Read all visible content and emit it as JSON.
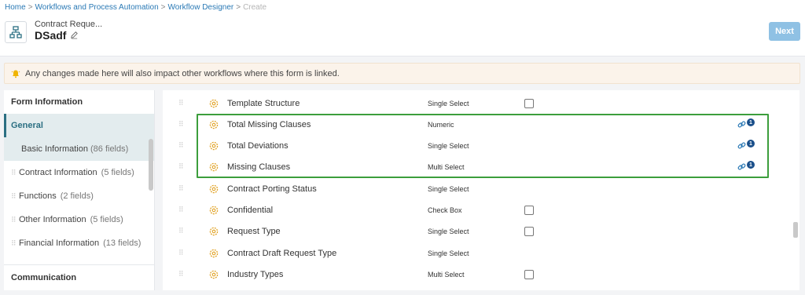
{
  "breadcrumb": {
    "home": "Home",
    "workflows": "Workflows and Process Automation",
    "designer": "Workflow Designer",
    "current": "Create",
    "separator": ">"
  },
  "header": {
    "subtitle": "Contract Reque...",
    "title": "DSadf",
    "next_label": "Next",
    "icon": "workflow-icon"
  },
  "alert": {
    "icon": "warning-bell-icon",
    "text": "Any changes made here will also impact other workflows where this form is linked."
  },
  "sidebar": {
    "form_info_label": "Form Information",
    "general_label": "General",
    "active_sub": {
      "label": "Basic Information",
      "count": "(86 fields)"
    },
    "items": [
      {
        "label": "Contract Information",
        "count": "(5 fields)"
      },
      {
        "label": "Functions",
        "count": "(2 fields)"
      },
      {
        "label": "Other Information",
        "count": "(5 fields)"
      },
      {
        "label": "Financial Information",
        "count": "(13 fields)"
      }
    ],
    "communication_label": "Communication"
  },
  "fields": [
    {
      "name": "Template Structure",
      "type": "Single Select",
      "checkbox": true,
      "linked": false,
      "link_count": ""
    },
    {
      "name": "Total Missing Clauses",
      "type": "Numeric",
      "checkbox": false,
      "linked": true,
      "link_count": "1"
    },
    {
      "name": "Total Deviations",
      "type": "Single Select",
      "checkbox": false,
      "linked": true,
      "link_count": "1"
    },
    {
      "name": "Missing Clauses",
      "type": "Multi Select",
      "checkbox": false,
      "linked": true,
      "link_count": "1"
    },
    {
      "name": "Contract Porting Status",
      "type": "Single Select",
      "checkbox": false,
      "linked": false,
      "link_count": ""
    },
    {
      "name": "Confidential",
      "type": "Check Box",
      "checkbox": true,
      "linked": false,
      "link_count": ""
    },
    {
      "name": "Request Type",
      "type": "Single Select",
      "checkbox": true,
      "linked": false,
      "link_count": ""
    },
    {
      "name": "Contract Draft Request Type",
      "type": "Single Select",
      "checkbox": false,
      "linked": false,
      "link_count": ""
    },
    {
      "name": "Industry Types",
      "type": "Multi Select",
      "checkbox": true,
      "linked": false,
      "link_count": ""
    }
  ],
  "colors": {
    "accent": "#2b6f82",
    "next_button": "#8fc1e4",
    "highlight_border": "#3c9e3c",
    "field_icon": "#e0a020",
    "link_badge": "#1a4f8a"
  }
}
